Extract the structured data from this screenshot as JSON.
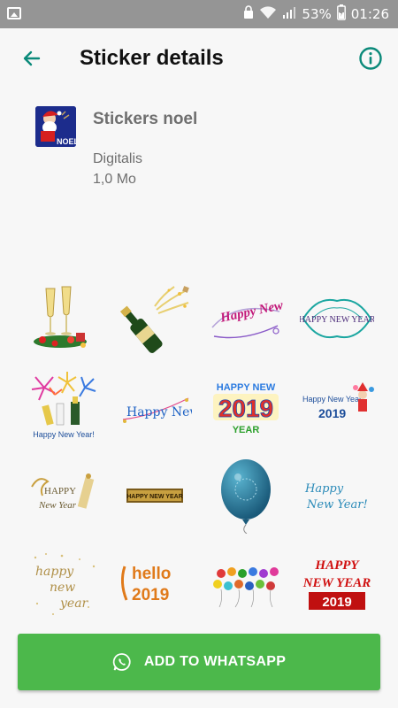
{
  "status_bar": {
    "battery": "53%",
    "time": "01:26"
  },
  "app_bar": {
    "title": "Sticker details"
  },
  "pack": {
    "name": "Stickers noel",
    "publisher": "Digitalis",
    "size": "1,0 Mo",
    "tray_text": "NOEL"
  },
  "stickers": {
    "s2": "Happy New Year",
    "s3": "HAPPY NEW YEAR",
    "s4": "Happy New Year!",
    "s5": "Happy Newyear",
    "s6a": "HAPPY NEW",
    "s6b": "2019",
    "s6c": "YEAR",
    "s7a": "Happy New Year",
    "s7b": "2019",
    "s8a": "HAPPY",
    "s8b": "New Year",
    "s9": "HAPPY NEW YEAR",
    "s11a": "Happy",
    "s11b": "New Year!",
    "s12a": "happy",
    "s12b": "new",
    "s12c": "year",
    "s13a": "hello",
    "s13b": "2019",
    "s15a": "HAPPY",
    "s15b": "NEW YEAR",
    "s15c": "2019"
  },
  "colors": {
    "accent": "#0b8a7a",
    "button": "#4cb84b"
  },
  "add_button": {
    "label": "ADD TO WHATSAPP"
  }
}
